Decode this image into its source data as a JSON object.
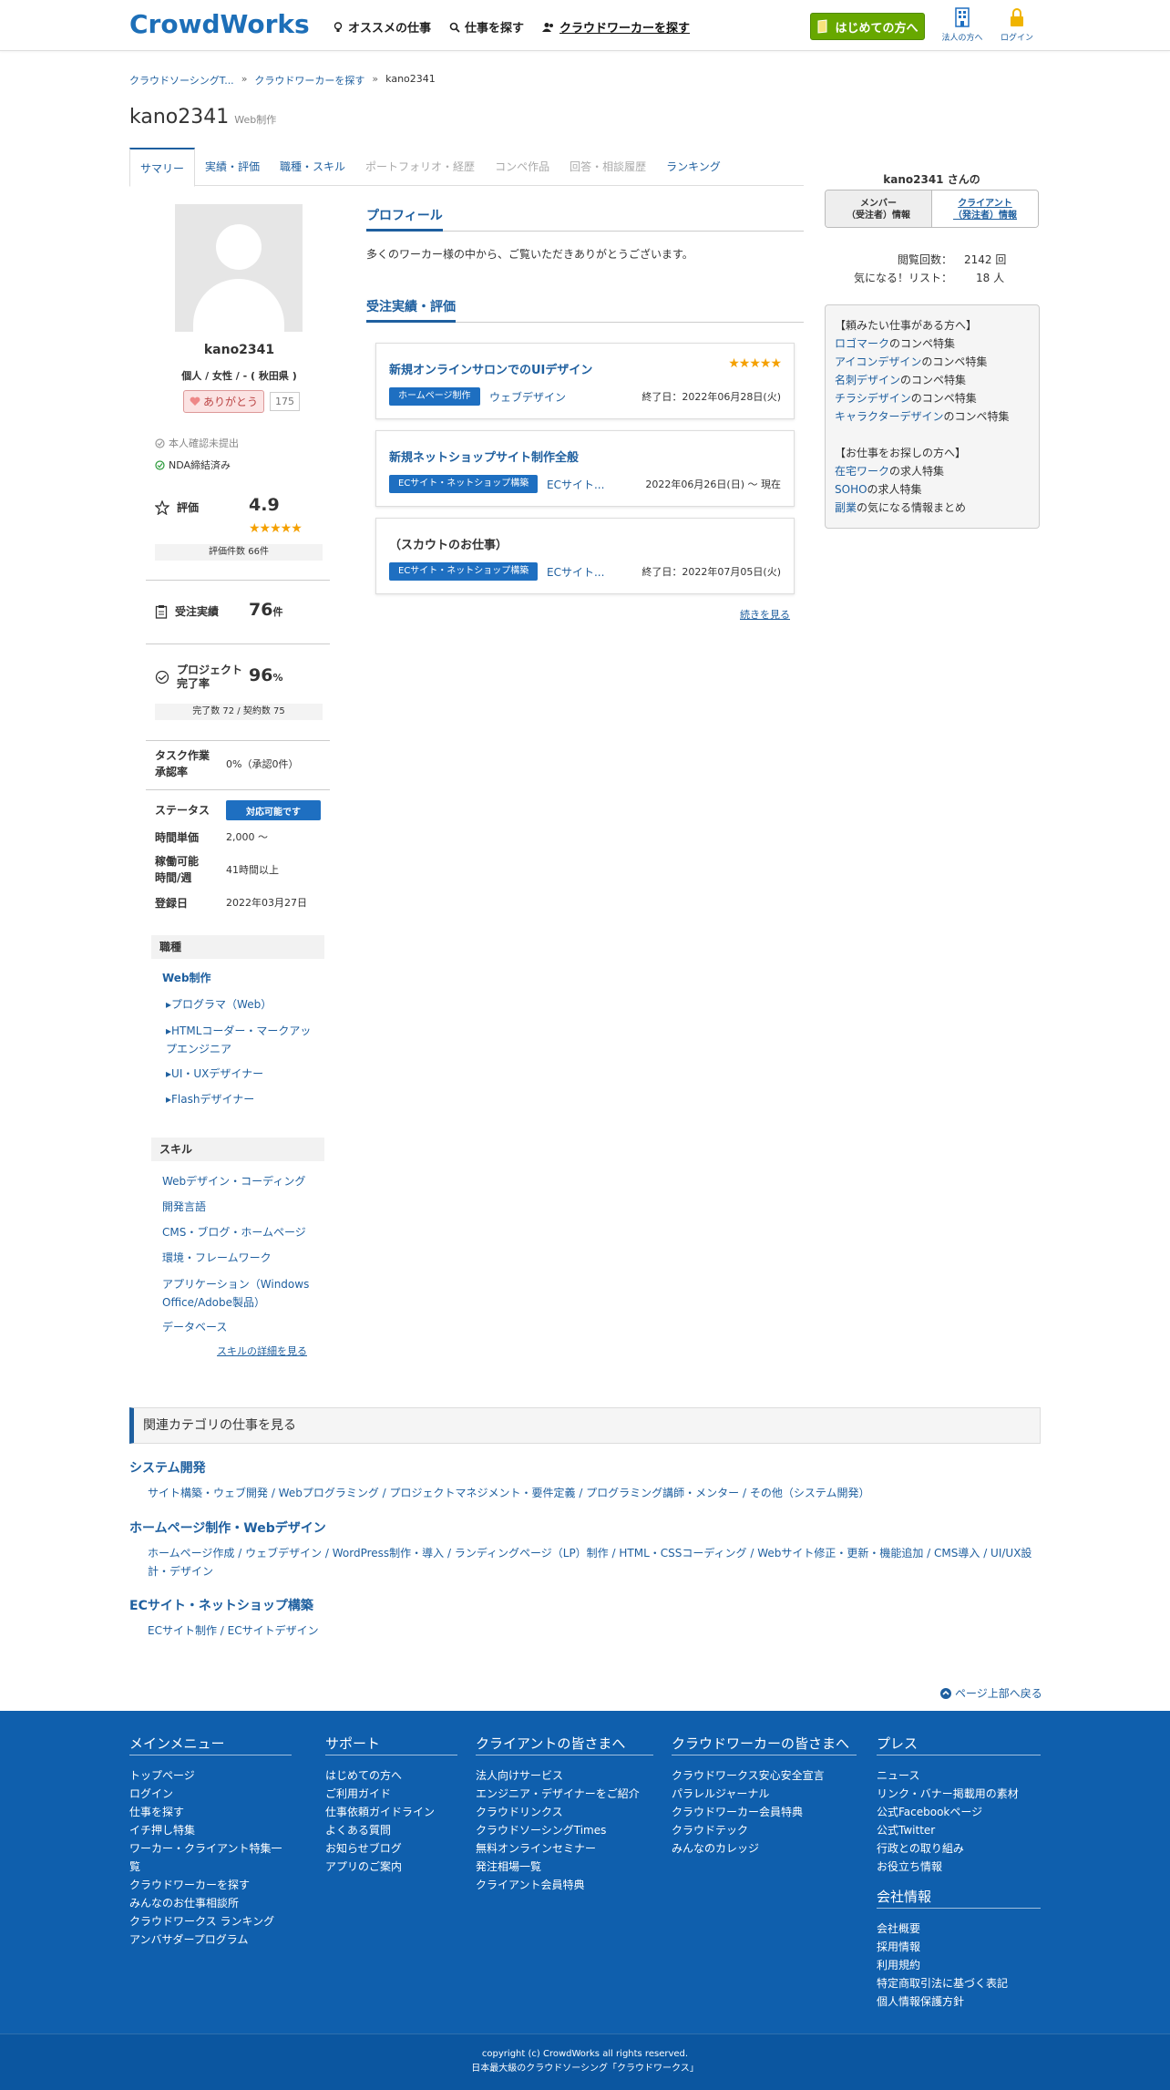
{
  "header": {
    "logo": "CrowdWorks",
    "nav": [
      {
        "label": "オススメの仕事",
        "icon": "bulb-icon"
      },
      {
        "label": "仕事を探す",
        "icon": "search-icon"
      },
      {
        "label": "クラウドワーカーを探す",
        "icon": "users-icon"
      }
    ],
    "begin_button": "はじめての方へ",
    "corporate_label": "法人の方へ",
    "login_label": "ログイン"
  },
  "breadcrumb": [
    "クラウドソーシングT...",
    "クラウドワーカーを探す",
    "kano2341"
  ],
  "user": {
    "name": "kano2341",
    "category": "Web制作"
  },
  "tabs": [
    "サマリー",
    "実績・評価",
    "職種・スキル",
    "ポートフォリオ・経歴",
    "コンペ作品",
    "回答・相談履歴",
    "ランキング"
  ],
  "profile_card": {
    "name": "kano2341",
    "sub": "個人 / 女性 / - ( 秋田県 )",
    "thanks_label": "ありがとう",
    "thanks_count": "175",
    "verify": "本人確認未提出",
    "nda": "NDA締結済み"
  },
  "stats": {
    "rating_label": "評価",
    "rating_value": "4.9",
    "rating_stars": 5,
    "rating_count": "評価件数 66件",
    "orders_label": "受注実績",
    "orders_value": "76",
    "orders_unit": "件",
    "completion_label_1": "プロジェクト",
    "completion_label_2": "完了率",
    "completion_value": "96",
    "completion_unit": "%",
    "completion_detail": "完了数 72 / 契約数 75",
    "task_label_1": "タスク作業",
    "task_label_2": "承認率",
    "task_value": "0%（承認0件）",
    "status_label": "ステータス",
    "status_value": "対応可能です",
    "rate_label": "時間単価",
    "rate_value": "2,000 〜",
    "hours_label_1": "稼働可能",
    "hours_label_2": "時間/週",
    "hours_value": "41時間以上",
    "reg_label": "登録日",
    "reg_value": "2022年03月27日"
  },
  "jobs_section": {
    "title": "職種",
    "main": "Web制作",
    "items": [
      "プログラマ（Web）",
      "HTMLコーダー・マークアップエンジニア",
      "UI・UXデザイナー",
      "Flashデザイナー"
    ]
  },
  "skills_section": {
    "title": "スキル",
    "items": [
      "Webデザイン・コーディング",
      "開発言語",
      "CMS・ブログ・ホームページ",
      "環境・フレームワーク",
      "アプリケーション（Windows Office/Adobe製品）",
      "データベース"
    ],
    "more": "スキルの詳細を見る"
  },
  "profile": {
    "heading": "プロフィール",
    "text": "多くのワーカー様の中から、ご覧いただきありがとうございます。"
  },
  "works": {
    "heading": "受注実績・評価",
    "cards": [
      {
        "title": "新規オンラインサロンでのUIデザイン",
        "tag": "ホームページ制作",
        "category": "ウェブデザイン",
        "date": "終了日：2022年06月28日(火)",
        "stars": 5
      },
      {
        "title": "新規ネットショップサイト制作全般",
        "tag": "ECサイト・ネットショップ構築",
        "category": "ECサイト...",
        "date": "2022年06月26日(日) 〜 現在"
      },
      {
        "title": "（スカウトのお仕事）",
        "tag": "ECサイト・ネットショップ構築",
        "category": "ECサイト...",
        "date": "終了日：2022年07月05日(火)"
      }
    ],
    "more": "続きを見る"
  },
  "right": {
    "name": "kano2341 さんの",
    "tab_member": "メンバー\n（受注者）情報",
    "tab_client": "クライアント\n（発注者）情報",
    "views_label": "閲覧回数：",
    "views_value": "2142 回",
    "fav_label": "気になる！リスト：",
    "fav_value": "18 人",
    "box_head1": "【頼みたい仕事がある方へ】",
    "box_links1": [
      {
        "link": "ロゴマーク",
        "rest": "のコンペ特集"
      },
      {
        "link": "アイコンデザイン",
        "rest": "のコンペ特集"
      },
      {
        "link": "名刺デザイン",
        "rest": "のコンペ特集"
      },
      {
        "link": "チラシデザイン",
        "rest": "のコンペ特集"
      },
      {
        "link": "キャラクターデザイン",
        "rest": "のコンペ特集"
      }
    ],
    "box_head2": "【お仕事をお探しの方へ】",
    "box_links2": [
      {
        "link": "在宅ワーク",
        "rest": "の求人特集"
      },
      {
        "link": "SOHO",
        "rest": "の求人特集"
      },
      {
        "link": "副業",
        "rest": "の気になる情報まとめ"
      }
    ]
  },
  "related": {
    "heading": "関連カテゴリの仕事を見る",
    "groups": [
      {
        "title": "システム開発",
        "links": "サイト構築・ウェブ開発 / Webプログラミング / プロジェクトマネジメント・要件定義 / プログラミング講師・メンター / その他（システム開発）"
      },
      {
        "title": "ホームページ制作・Webデザイン",
        "links": "ホームページ作成 / ウェブデザイン / WordPress制作・導入 / ランディングページ（LP）制作 / HTML・CSSコーディング / Webサイト修正・更新・機能追加 / CMS導入 / UI/UX設計・デザイン"
      },
      {
        "title": "ECサイト・ネットショップ構築",
        "links": "ECサイト制作 / ECサイトデザイン"
      }
    ]
  },
  "to_top": "ページ上部へ戻る",
  "footer": {
    "cols": [
      {
        "title": "メインメニュー",
        "items": [
          "トップページ",
          "ログイン",
          "仕事を探す",
          "イチ押し特集",
          "ワーカー・クライアント特集一覧",
          "クラウドワーカーを探す",
          "みんなのお仕事相談所",
          "クラウドワークス ランキング",
          "アンバサダープログラム"
        ]
      },
      {
        "title": "サポート",
        "items": [
          "はじめての方へ",
          "ご利用ガイド",
          "仕事依頼ガイドライン",
          "よくある質問",
          "お知らせブログ",
          "アプリのご案内"
        ]
      },
      {
        "title": "クライアントの皆さまへ",
        "items": [
          "法人向けサービス",
          "エンジニア・デザイナーをご紹介",
          "クラウドリンクス",
          "クラウドソーシングTimes",
          "無料オンラインセミナー",
          "発注相場一覧",
          "クライアント会員特典"
        ]
      },
      {
        "title": "クラウドワーカーの皆さまへ",
        "items": [
          "クラウドワークス安心安全宣言",
          "パラレルジャーナル",
          "クラウドワーカー会員特典",
          "クラウドテック",
          "みんなのカレッジ"
        ]
      },
      {
        "title": "プレス",
        "items": [
          "ニュース",
          "リンク・バナー掲載用の素材",
          "公式Facebookページ",
          "公式Twitter",
          "行政との取り組み",
          "お役立ち情報"
        ]
      },
      {
        "title": "会社情報",
        "items": [
          "会社概要",
          "採用情報",
          "利用規約",
          "特定商取引法に基づく表記",
          "個人情報保護方針"
        ]
      }
    ],
    "copyright": "copyright (c) CrowdWorks all rights reserved.",
    "tagline": "日本最大級のクラウドソーシング「クラウドワークス」"
  }
}
